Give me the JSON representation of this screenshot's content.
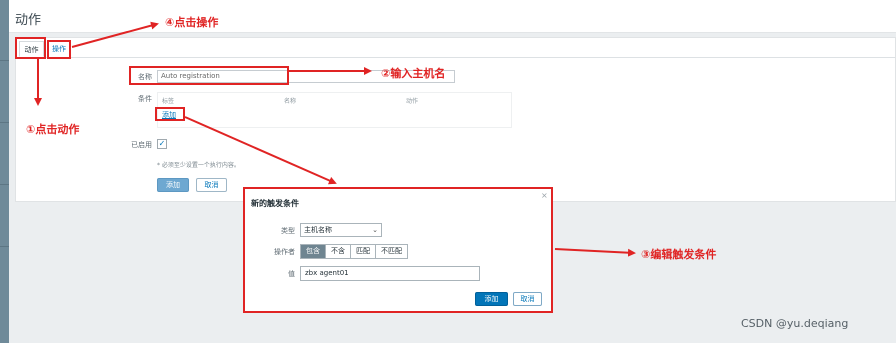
{
  "page": {
    "title": "动作"
  },
  "tabs": {
    "action": "动作",
    "operations": "操作"
  },
  "form": {
    "name_label": "名称",
    "name_value": "Auto registration",
    "conditions_label": "条件",
    "cond_headers": [
      "标签",
      "名称",
      "动作"
    ],
    "add_link": "添加",
    "enabled_label": "已启用",
    "enabled_check": "✓",
    "hint": "* 必须至少设置一个执行内容。",
    "add_button": "添加",
    "cancel_button": "取消"
  },
  "modal": {
    "title": "新的触发条件",
    "close": "×",
    "type_label": "类型",
    "type_value": "主机名称",
    "type_chevron": "⌄",
    "operator_label": "操作者",
    "operators": [
      "包含",
      "不含",
      "匹配",
      "不匹配"
    ],
    "active_operator": "包含",
    "value_label": "值",
    "value": "zbx agent01",
    "add_button": "添加",
    "cancel_button": "取消"
  },
  "annotations": {
    "step1": "①点击动作",
    "step2": "②输入主机名",
    "step3": "③编辑触发条件",
    "step4": "④点击操作"
  },
  "watermark": "CSDN @yu.deqiang",
  "colors": {
    "annotation": "#e02424",
    "link": "#0275b8",
    "primary": "#0275b8",
    "active_segment": "#6f8591"
  },
  "icons": {
    "checkbox": "check-icon",
    "close": "close-icon",
    "select": "chevron-down-icon"
  }
}
